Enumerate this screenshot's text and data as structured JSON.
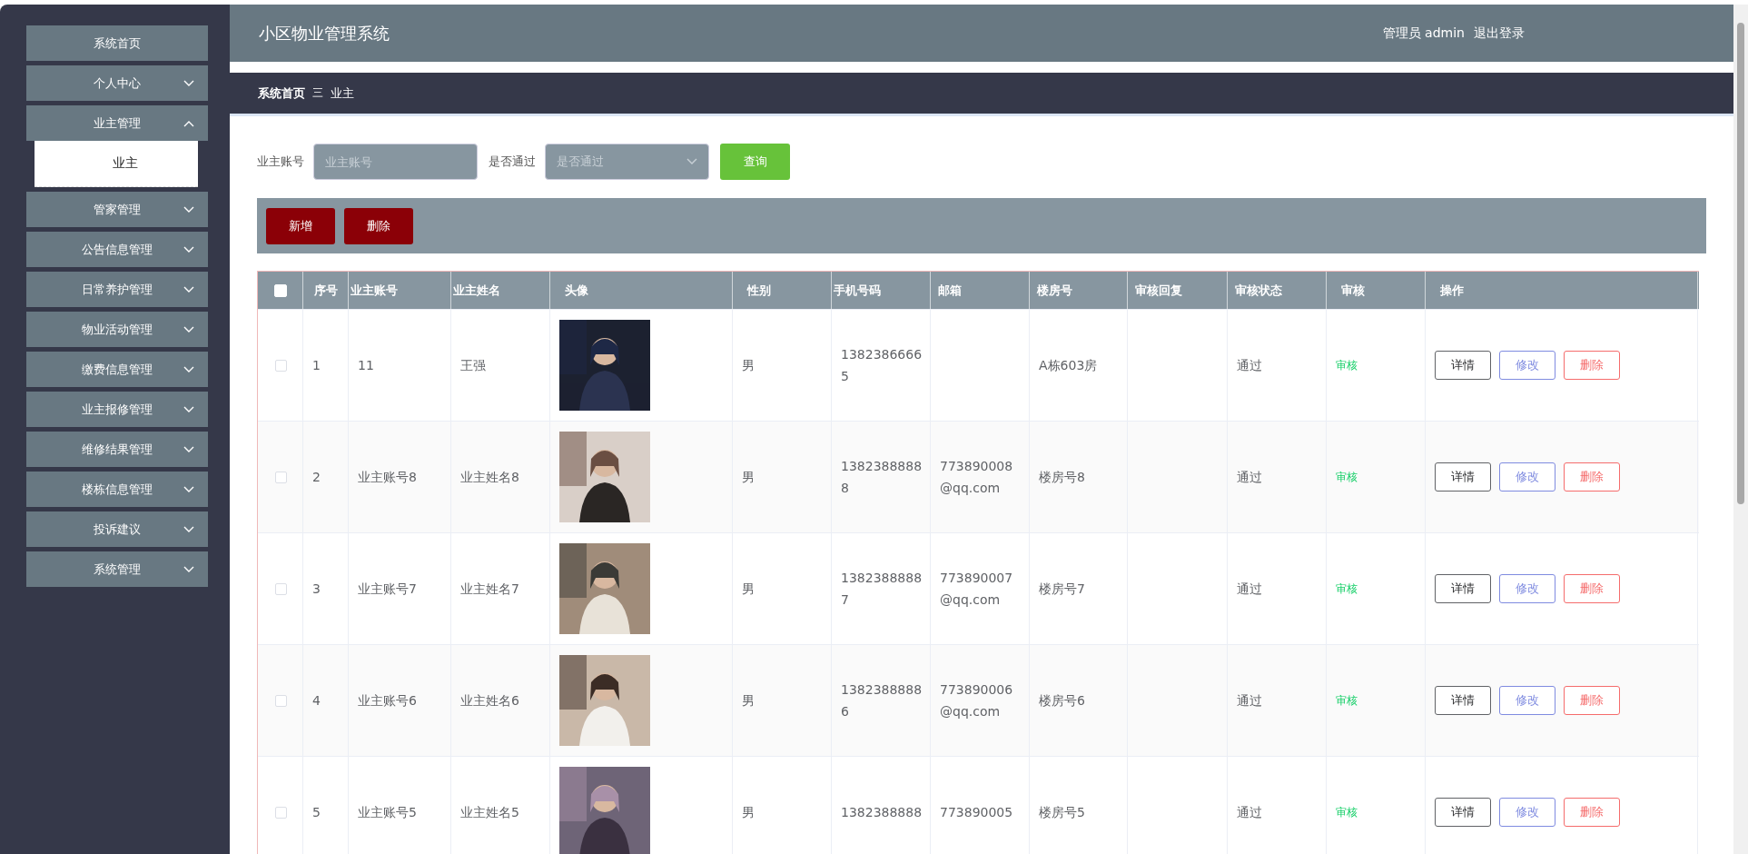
{
  "sidebar": {
    "items": [
      {
        "label": "系统首页",
        "kind": "link"
      },
      {
        "label": "个人中心",
        "kind": "menu",
        "expanded": false
      },
      {
        "label": "业主管理",
        "kind": "menu",
        "expanded": true,
        "children": [
          {
            "label": "业主"
          }
        ]
      },
      {
        "label": "管家管理",
        "kind": "menu",
        "expanded": false
      },
      {
        "label": "公告信息管理",
        "kind": "menu",
        "expanded": false
      },
      {
        "label": "日常养护管理",
        "kind": "menu",
        "expanded": false
      },
      {
        "label": "物业活动管理",
        "kind": "menu",
        "expanded": false
      },
      {
        "label": "缴费信息管理",
        "kind": "menu",
        "expanded": false
      },
      {
        "label": "业主报修管理",
        "kind": "menu",
        "expanded": false
      },
      {
        "label": "维修结果管理",
        "kind": "menu",
        "expanded": false
      },
      {
        "label": "楼栋信息管理",
        "kind": "menu",
        "expanded": false
      },
      {
        "label": "投诉建议",
        "kind": "menu",
        "expanded": false
      },
      {
        "label": "系统管理",
        "kind": "menu",
        "expanded": false
      }
    ]
  },
  "header": {
    "title": "小区物业管理系统",
    "user": "管理员 admin",
    "logout": "退出登录"
  },
  "breadcrumb": {
    "items": [
      "系统首页",
      "业主"
    ],
    "separator": "三"
  },
  "search": {
    "fields": [
      {
        "label": "业主账号",
        "kind": "input",
        "placeholder": "业主账号"
      },
      {
        "label": "是否通过",
        "kind": "select",
        "placeholder": "是否通过"
      }
    ],
    "button": "查询"
  },
  "toolbar": {
    "buttons": [
      "新增",
      "删除"
    ]
  },
  "table": {
    "header_checked": false,
    "columns": [
      "序号",
      "业主账号",
      "业主姓名",
      "头像",
      "性别",
      "手机号码",
      "邮箱",
      "楼房号",
      "审核回复",
      "审核状态",
      "审核",
      "操作"
    ],
    "rows": [
      {
        "checked": false,
        "index": "1",
        "account": "11",
        "name": "王强",
        "gender": "男",
        "phone": "13823866665",
        "email": "",
        "building": "A栋603房",
        "reply": "",
        "status": "通过",
        "audit": "审核",
        "actions": [
          "详情",
          "修改",
          "删除"
        ]
      },
      {
        "checked": false,
        "index": "2",
        "account": "业主账号8",
        "name": "业主姓名8",
        "gender": "男",
        "phone": "13823888888",
        "email": "773890008@qq.com",
        "building": "楼房号8",
        "reply": "",
        "status": "通过",
        "audit": "审核",
        "actions": [
          "详情",
          "修改",
          "删除"
        ]
      },
      {
        "checked": false,
        "index": "3",
        "account": "业主账号7",
        "name": "业主姓名7",
        "gender": "男",
        "phone": "13823888887",
        "email": "773890007@qq.com",
        "building": "楼房号7",
        "reply": "",
        "status": "通过",
        "audit": "审核",
        "actions": [
          "详情",
          "修改",
          "删除"
        ]
      },
      {
        "checked": false,
        "index": "4",
        "account": "业主账号6",
        "name": "业主姓名6",
        "gender": "男",
        "phone": "13823888886",
        "email": "773890006@qq.com",
        "building": "楼房号6",
        "reply": "",
        "status": "通过",
        "audit": "审核",
        "actions": [
          "详情",
          "修改",
          "删除"
        ]
      },
      {
        "checked": false,
        "index": "5",
        "account": "业主账号5",
        "name": "业主姓名5",
        "gender": "男",
        "phone": "1382388888",
        "email": "773890005",
        "building": "楼房号5",
        "reply": "",
        "status": "通过",
        "audit": "审核",
        "actions": [
          "详情",
          "修改",
          "删除"
        ]
      }
    ]
  }
}
